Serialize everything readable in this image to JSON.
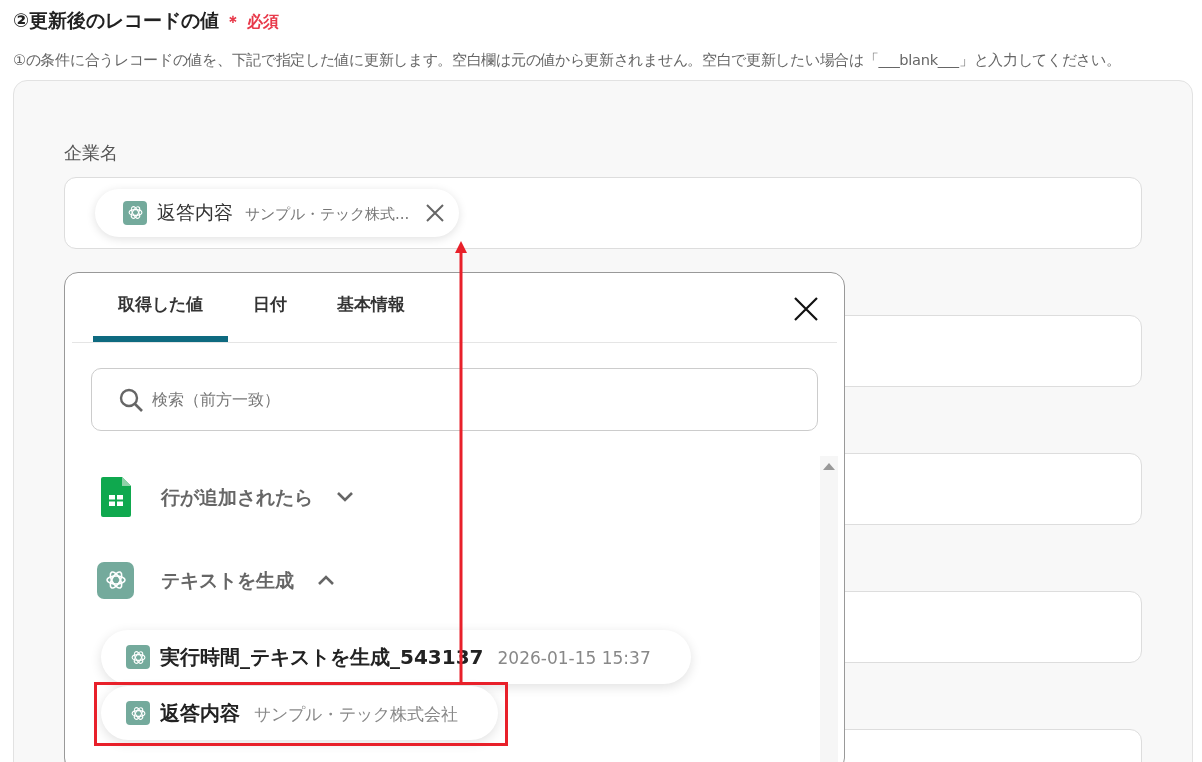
{
  "section": {
    "number": "②",
    "title": "更新後のレコードの値",
    "required_mark": "＊",
    "required_label": "必須",
    "description": "①の条件に合うレコードの値を、下記で指定した値に更新します。空白欄は元の値から更新されません。空白で更新したい場合は「___blank___」と入力してください。"
  },
  "fields": [
    {
      "kind": "labeled",
      "label": "企業名",
      "chip": {
        "name": "返答内容",
        "value": "サンプル・テック株式..."
      }
    },
    {
      "kind": "covered"
    },
    {
      "kind": "covered"
    },
    {
      "kind": "covered"
    },
    {
      "kind": "covered"
    }
  ],
  "dropdown": {
    "tabs": [
      {
        "label": "取得した値",
        "selected": true
      },
      {
        "label": "日付",
        "selected": false
      },
      {
        "label": "基本情報",
        "selected": false
      }
    ],
    "search": {
      "placeholder": "検索（前方一致）"
    },
    "groups": [
      {
        "title": "行が追加されたら",
        "kind": "sheet",
        "expanded": false
      },
      {
        "title": "テキストを生成",
        "kind": "ai",
        "expanded": true,
        "children": [
          {
            "name": "実行時間_テキストを生成_543137",
            "value": "2026-01-15 15:37",
            "callout": false
          },
          {
            "name": "返答内容",
            "value": "サンプル・テック株式会社",
            "callout": true
          }
        ]
      }
    ]
  }
}
